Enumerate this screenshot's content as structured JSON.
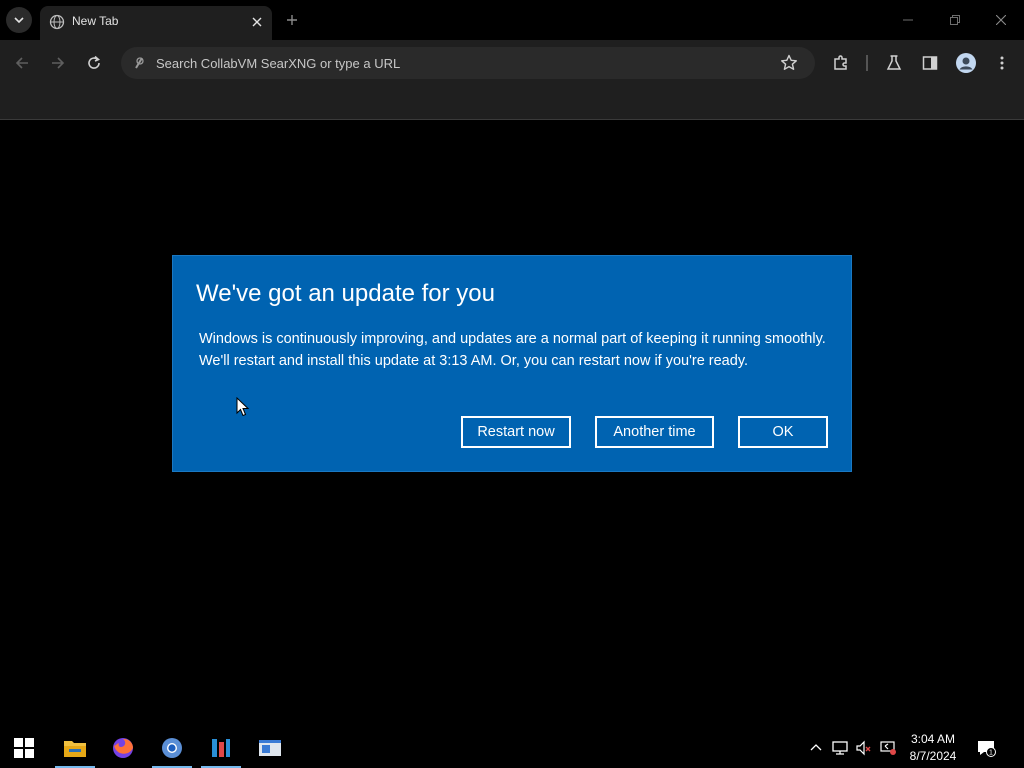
{
  "browser": {
    "tab_title": "New Tab",
    "omnibox_placeholder": "Search CollabVM SearXNG or type a URL"
  },
  "dialog": {
    "heading": "We've got an update for you",
    "body": "Windows is continuously improving, and updates are a normal part of keeping it running smoothly. We'll restart and install this update at 3:13 AM. Or, you can restart now if you're ready.",
    "buttons": {
      "restart_now": "Restart now",
      "another_time": "Another time",
      "ok": "OK"
    },
    "background_color": "#0063b1"
  },
  "taskbar": {
    "apps": [
      "start-icon",
      "file-explorer-icon",
      "firefox-icon",
      "chromium-icon",
      "app-icon",
      "window-app-icon"
    ],
    "clock_time": "3:04 AM",
    "clock_date": "8/7/2024",
    "notification_count": "1"
  }
}
